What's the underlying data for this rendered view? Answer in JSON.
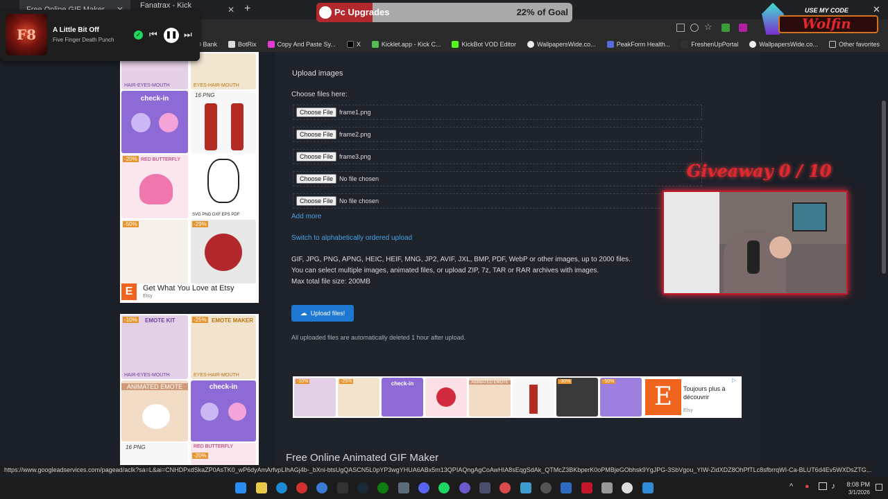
{
  "tabs": [
    {
      "label": "Free Online GIF Maker"
    },
    {
      "label": "Fanatrax - Kick Dashboard"
    }
  ],
  "goal": {
    "label": "Pc Upgrades",
    "progress_text": "22% of Goal",
    "progress": 0.22
  },
  "creator": {
    "caption": "USE MY CODE",
    "code": "Wolfin"
  },
  "media": {
    "song": "A Little Bit Off",
    "artist": "Five Finger Death Punch",
    "art_label": "F8"
  },
  "bookmarks": [
    "TD Bank",
    "BotRix",
    "Copy And Paste Sy...",
    "X",
    "Kicklet.app - Kick C...",
    "KickBot VOD Editor",
    "WallpapersWide.co...",
    "PeakForm Health...",
    "FreshenUpPortal",
    "WallpapersWide.co...",
    "Other favorites"
  ],
  "upload": {
    "heading": "Upload images",
    "choose_label": "Choose files here:",
    "button_label": "Choose File",
    "files": [
      "frame1.png",
      "frame2.png",
      "frame3.png",
      "No file chosen",
      "No file chosen"
    ],
    "add_more": "Add more",
    "switch_link": "Switch to alphabetically ordered upload",
    "info1": "GIF, JPG, PNG, APNG, HEIC, HEIF, MNG, JP2, AVIF, JXL, BMP, PDF, WebP or other images, up to 2000 files.",
    "info2": "You can select multiple images, animated files, or upload ZIP, 7z, TAR or RAR archives with images.",
    "info3": "Max total file size: 200MB",
    "submit": "Upload files!",
    "note": "All uploaded files are automatically deleted 1 hour after upload."
  },
  "ads": {
    "etsy_text": "Get What You Love at Etsy",
    "etsy_sub": "Etsy",
    "etsy_logo": "E",
    "banner_text": "Toujours plus à découvrir",
    "banner_sub": "Etsy",
    "left_top_labels": [
      "HAIR-EYES-MOUTH",
      "EYES-HAIR-MOUTH",
      "check-in",
      "16 PNG",
      "-20%",
      "RED BUTTERFLY",
      "SVG PNG DXF EPS PDF",
      "-50%",
      "-29%"
    ],
    "left_bottom_labels": [
      "-10%",
      "EMOTE KIT",
      "-25%",
      "EMOTE MAKER",
      "HAIR-EYES-MOUTH",
      "EYES-HAIR-MOUTH",
      "ANIMATED EMOTE",
      "check-in",
      "16 PNG",
      "RED BUTTERFLY",
      "-20%"
    ],
    "banner_labels": [
      "-10%",
      "-25%",
      "check-in",
      "ANIMATED EMOTE",
      "-30%",
      "-50%"
    ]
  },
  "giveaway": "Giveaway 0 / 10",
  "bottom_heading": "Free Online Animated GIF Maker",
  "status_url": "https://www.googleadservices.com/pagead/aclk?sa=L&ai=CNHDPxdSkaZP0AsTK0_wP6dyAmArfvpLIhAGj4b-_bXni-btsUgQASCN5L0pYP3wgYHUA6ABx5m13QPIAQngAgCoAwHIA8sEqgSdAk_QTMcZ3BKbperK0oPMBjeGObhsk9YgJPG-3SbVgou_YIW-ZidXDZ8OhPfTLc8sfbrrqWI-Ca-BLUT6d4Ev5WXDsZTG...",
  "clock": {
    "time": "8:08 PM",
    "date": "3/1/2026"
  },
  "colors": {
    "accent": "#1e78d2",
    "link": "#4aa3e6",
    "goal_fill": "#b3282d",
    "giveaway": "#c4172b"
  },
  "icons": [
    "windows-start-icon",
    "file-explorer-icon",
    "edge-icon",
    "vivaldi-icon",
    "browser-icon",
    "epic-games-icon",
    "steam-icon",
    "xbox-icon",
    "discord-icon",
    "spotify-icon",
    "app-icon",
    "app-icon",
    "app-icon",
    "app-icon",
    "app-icon",
    "app-icon",
    "app-icon",
    "app-icon",
    "app-icon"
  ]
}
